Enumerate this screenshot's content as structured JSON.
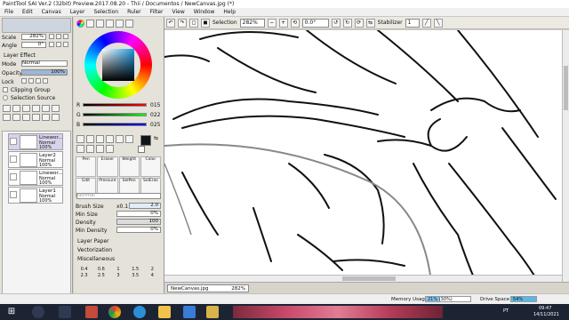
{
  "window": {
    "title": "PaintTool SAI Ver.2 (32bit) Preview.2017.08.20 - Thii / Documentos / NewCanvas.jpg (*)"
  },
  "menu": [
    "File",
    "Edit",
    "Canvas",
    "Layer",
    "Selection",
    "Ruler",
    "Filter",
    "View",
    "Window",
    "Help"
  ],
  "toolbar": {
    "selection_label": "Selection",
    "zoom": "282%",
    "rotation": "0.0°",
    "stabilizer_label": "Stabilizer",
    "stabilizer_value": "1"
  },
  "nav": {
    "scale_label": "Scale",
    "scale_value": "282%",
    "angle_label": "Angle",
    "angle_value": "0°"
  },
  "layer_effect": {
    "header": "Layer Effect",
    "mode_label": "Mode",
    "mode_value": "Normal",
    "opacity_label": "Opacity",
    "opacity_value": "100%",
    "lock_label": "Lock",
    "clipping_label": "Clipping Group",
    "selection_source_label": "Selection Source"
  },
  "layers": [
    {
      "name": "Linewor...",
      "mode": "Normal",
      "opacity": "100%"
    },
    {
      "name": "Layer2",
      "mode": "Normal",
      "opacity": "100%"
    },
    {
      "name": "Linewor...",
      "mode": "Normal",
      "opacity": "100%"
    },
    {
      "name": "Layer1",
      "mode": "Normal",
      "opacity": "100%"
    }
  ],
  "color": {
    "r_label": "R",
    "g_label": "G",
    "b_label": "B",
    "r_value": "015",
    "g_value": "022",
    "b_value": "025",
    "current": "#0f1619"
  },
  "tools_row1": [
    "Pen",
    "Eraser",
    "Weight",
    "Color"
  ],
  "tools_row2": [
    "Edit",
    "Pressure",
    "SelPen",
    "SelEras"
  ],
  "brush": {
    "mode_value": "Normal",
    "size_label": "Brush Size",
    "size_mult": "x0.1",
    "size_value": "2.0",
    "min_size_label": "Min Size",
    "min_size_value": "0%",
    "density_label": "Density",
    "density_value": "100",
    "min_density_label": "Min Density",
    "min_density_value": "0%"
  },
  "sections": [
    "Layer Paper",
    "Vectorization",
    "Miscellaneous"
  ],
  "size_presets": [
    "0.4",
    "0.6",
    "1",
    "1.5",
    "2",
    "2.3",
    "2.5",
    "3",
    "3.5",
    "4"
  ],
  "tab": {
    "name": "NewCanvas.jpg",
    "zoom": "282%"
  },
  "status": {
    "memory_label": "Memory Usage",
    "memory_value": "21% (30%)",
    "drive_label": "Drive Space",
    "drive_value": "54%"
  },
  "taskbar": {
    "lang": "PT",
    "time": "09:47",
    "date": "14/11/2021"
  },
  "colors": {
    "accent": "#3c78d8",
    "status_memory": "#7ec6ea",
    "status_drive": "#5ab7e8"
  }
}
